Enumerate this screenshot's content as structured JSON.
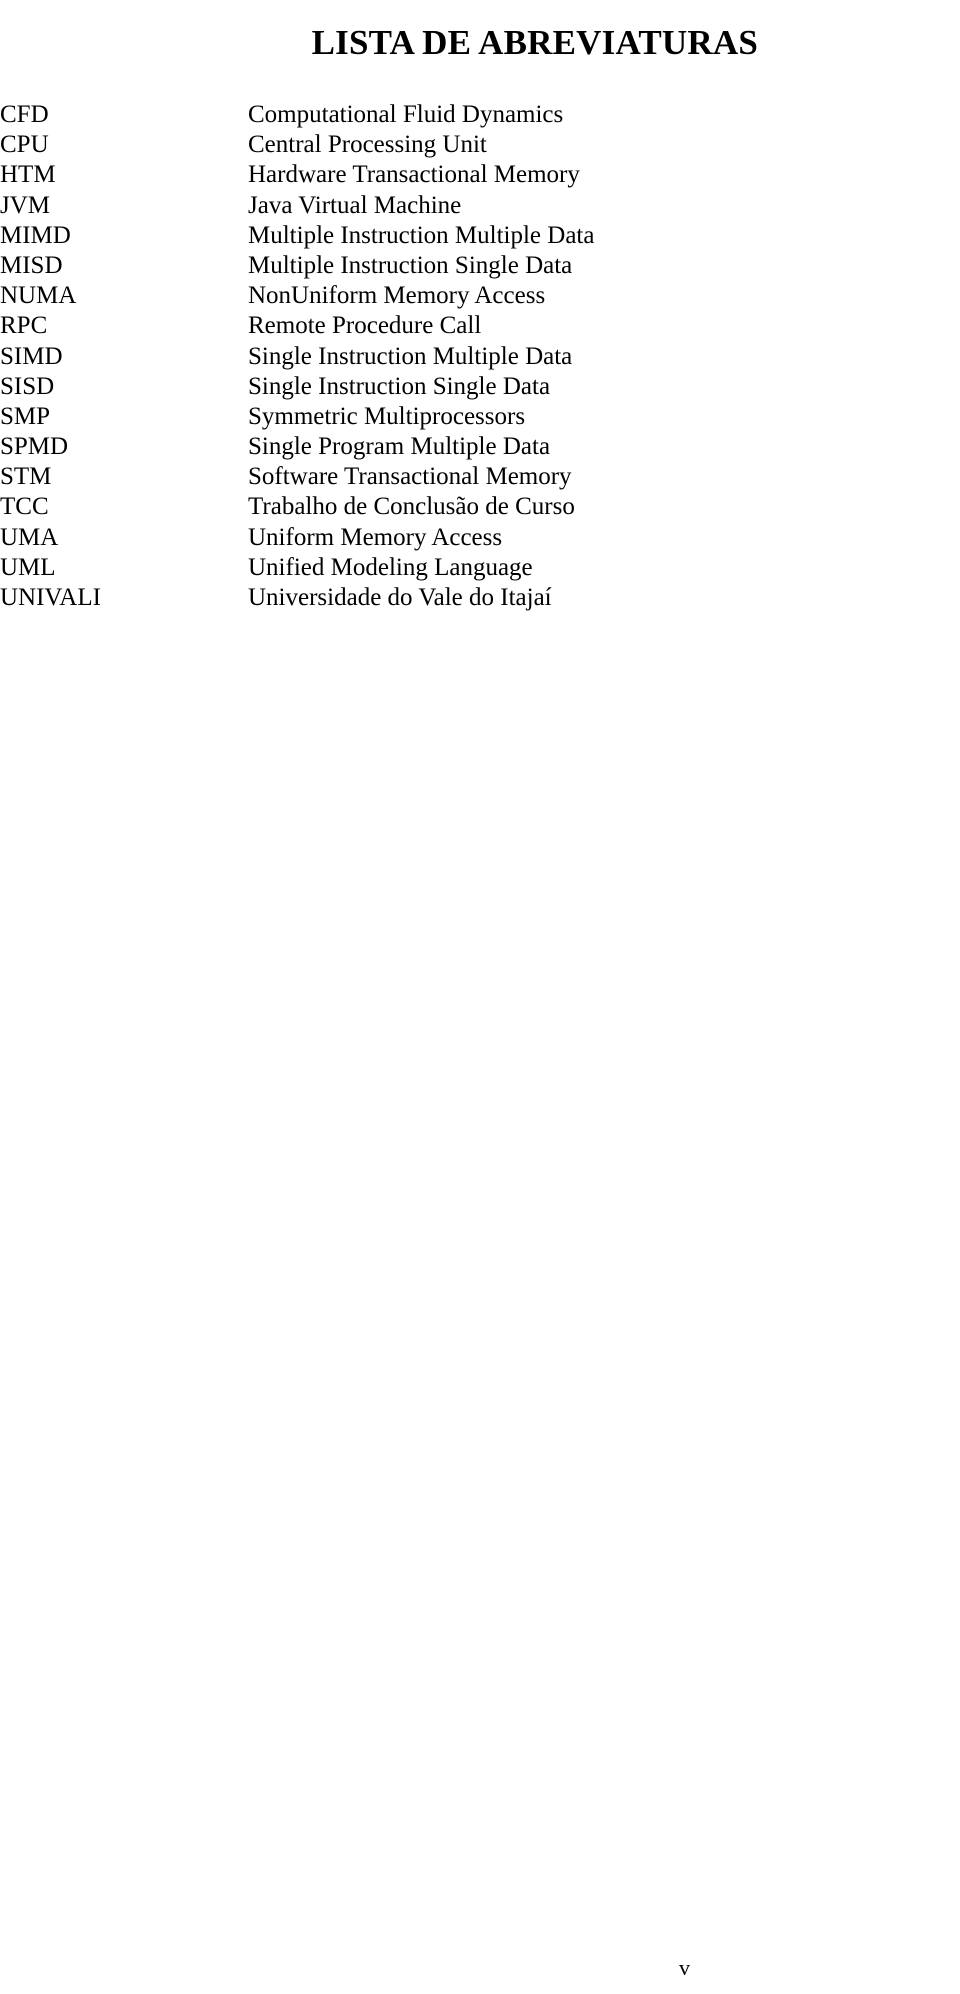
{
  "document": {
    "title": "LISTA DE ABREVIATURAS",
    "page_number": "v"
  },
  "abbreviations": [
    {
      "term": "CFD",
      "definition": "Computational Fluid Dynamics"
    },
    {
      "term": "CPU",
      "definition": "Central Processing Unit"
    },
    {
      "term": "HTM",
      "definition": "Hardware Transactional Memory"
    },
    {
      "term": "JVM",
      "definition": "Java Virtual Machine"
    },
    {
      "term": "MIMD",
      "definition": "Multiple Instruction Multiple Data"
    },
    {
      "term": "MISD",
      "definition": "Multiple Instruction Single Data"
    },
    {
      "term": "NUMA",
      "definition": "NonUniform Memory Access"
    },
    {
      "term": "RPC",
      "definition": "Remote Procedure Call"
    },
    {
      "term": "SIMD",
      "definition": "Single Instruction Multiple Data"
    },
    {
      "term": "SISD",
      "definition": "Single Instruction Single Data"
    },
    {
      "term": "SMP",
      "definition": "Symmetric Multiprocessors"
    },
    {
      "term": "SPMD",
      "definition": "Single Program Multiple Data"
    },
    {
      "term": "STM",
      "definition": "Software Transactional Memory"
    },
    {
      "term": "TCC",
      "definition": "Trabalho de Conclusão de Curso"
    },
    {
      "term": "UMA",
      "definition": "Uniform Memory Access"
    },
    {
      "term": "UML",
      "definition": "Unified Modeling Language"
    },
    {
      "term": "UNIVALI",
      "definition": "Universidade do Vale do Itajaí"
    }
  ]
}
